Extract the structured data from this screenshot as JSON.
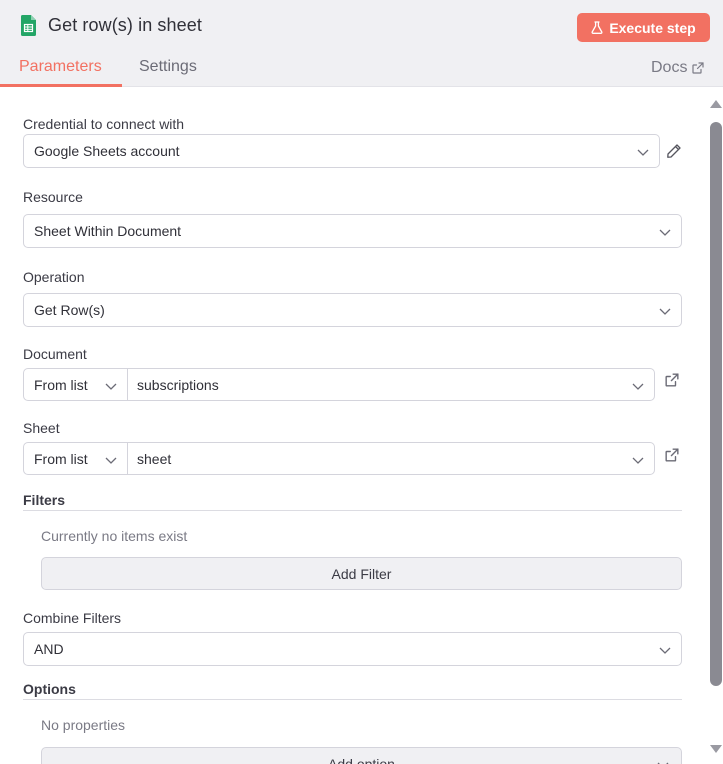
{
  "header": {
    "title": "Get row(s) in sheet",
    "node_icon": "google-sheets-icon",
    "execute_label": "Execute step",
    "execute_icon": "flask-icon"
  },
  "tabs": [
    {
      "label": "Parameters",
      "active": true
    },
    {
      "label": "Settings",
      "active": false
    }
  ],
  "docs": {
    "label": "Docs",
    "icon": "external-link-icon"
  },
  "form": {
    "credential": {
      "label": "Credential to connect with",
      "value": "Google Sheets account",
      "edit_icon": "pencil-icon"
    },
    "resource": {
      "label": "Resource",
      "value": "Sheet Within Document"
    },
    "operation": {
      "label": "Operation",
      "value": "Get Row(s)"
    },
    "document": {
      "label": "Document",
      "mode": "From list",
      "value": "subscriptions"
    },
    "sheet": {
      "label": "Sheet",
      "mode": "From list",
      "value": "sheet"
    },
    "filters": {
      "label": "Filters",
      "empty_text": "Currently no items exist",
      "add_label": "Add Filter"
    },
    "combine_filters": {
      "label": "Combine Filters",
      "value": "AND"
    },
    "options": {
      "label": "Options",
      "empty_text": "No properties",
      "add_label": "Add option"
    }
  },
  "colors": {
    "accent": "#f27162",
    "sheets_green": "#23a566"
  }
}
